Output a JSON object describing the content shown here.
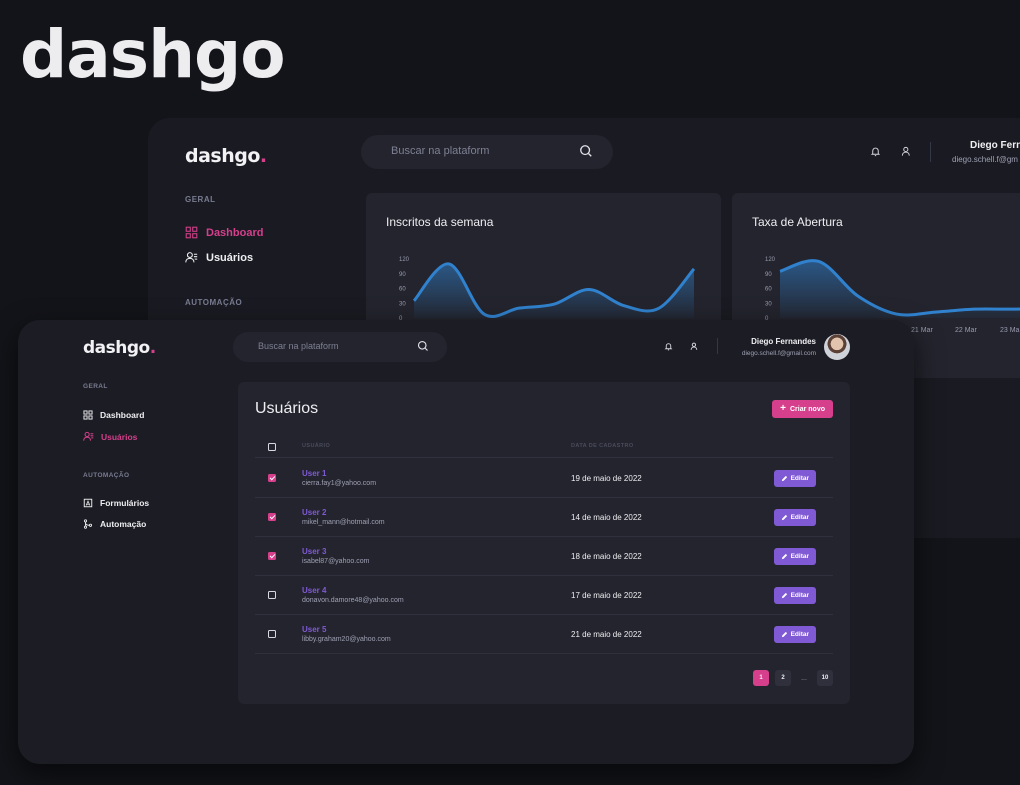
{
  "hero": {
    "title": "dashgo"
  },
  "app": {
    "logo_text": "dashgo",
    "logo_dot": "."
  },
  "search": {
    "placeholder": "Buscar na plataform"
  },
  "user": {
    "name": "Diego Fernandes",
    "email": "diego.schell.f@gmail.com"
  },
  "back_header": {
    "name_visible": "Diego Fern",
    "email_visible": "diego.schell.f@gm"
  },
  "sidebar": {
    "section_general": "GERAL",
    "section_automation": "AUTOMAÇÃO",
    "items": [
      {
        "label": "Dashboard",
        "icon": "dashboard-grid-icon"
      },
      {
        "label": "Usuários",
        "icon": "users-icon"
      },
      {
        "label": "Formulários",
        "icon": "form-icon"
      },
      {
        "label": "Automação",
        "icon": "git-merge-icon"
      }
    ]
  },
  "colors": {
    "accent": "#d53f8c",
    "purple": "#805ad5",
    "chart_line": "#3182ce",
    "bg": "#131419",
    "panel": "#23242d"
  },
  "dashboard": {
    "card1_title": "Inscritos da semana",
    "card2_title": "Taxa de Abertura",
    "x_ticks_visible": [
      "21 Mar",
      "22 Mar",
      "23 Ma"
    ]
  },
  "chart_data": [
    {
      "type": "area",
      "title": "Inscritos da semana",
      "y_ticks": [
        "120",
        "90",
        "60",
        "30",
        "0"
      ],
      "ylim": [
        0,
        120
      ],
      "x": [
        0,
        1,
        2,
        3,
        4,
        5,
        6,
        7,
        8
      ],
      "values": [
        35,
        110,
        8,
        20,
        28,
        58,
        25,
        20,
        100
      ]
    },
    {
      "type": "area",
      "title": "Taxa de Abertura",
      "y_ticks": [
        "120",
        "90",
        "60",
        "30",
        "0"
      ],
      "x_ticks_visible": [
        "21 Mar",
        "22 Mar",
        "23 Ma"
      ],
      "ylim": [
        0,
        120
      ],
      "x": [
        0,
        1,
        2,
        3,
        4,
        5,
        6,
        7
      ],
      "values": [
        95,
        115,
        45,
        8,
        12,
        18,
        18,
        20
      ]
    }
  ],
  "users_page": {
    "title": "Usuários",
    "create_button": "Criar novo",
    "col_user": "USUÁRIO",
    "col_date": "DATA DE CADASTRO",
    "edit_label": "Editar",
    "rows": [
      {
        "name": "User 1",
        "email": "cierra.fay1@yahoo.com",
        "date": "19 de maio de 2022",
        "checked": true
      },
      {
        "name": "User 2",
        "email": "mikel_mann@hotmail.com",
        "date": "14 de maio de 2022",
        "checked": true
      },
      {
        "name": "User 3",
        "email": "isabel87@yahoo.com",
        "date": "18 de maio de 2022",
        "checked": true
      },
      {
        "name": "User 4",
        "email": "donavon.damore48@yahoo.com",
        "date": "17 de maio de 2022",
        "checked": false
      },
      {
        "name": "User 5",
        "email": "libby.graham20@yahoo.com",
        "date": "21 de maio de 2022",
        "checked": false
      }
    ],
    "pagination": {
      "pages": [
        "1",
        "2",
        "...",
        "10"
      ],
      "current": "1"
    }
  }
}
